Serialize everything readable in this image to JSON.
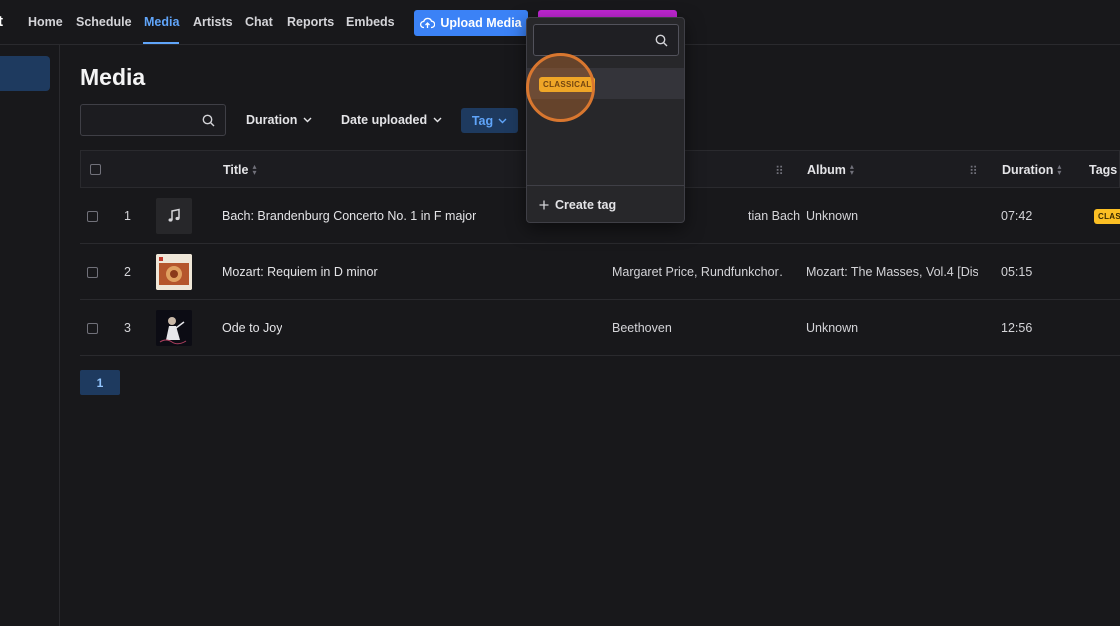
{
  "nav": {
    "logo_fragment": "t",
    "items": [
      "Home",
      "Schedule",
      "Media",
      "Artists",
      "Chat",
      "Reports",
      "Embeds"
    ],
    "upload_label": "Upload Media"
  },
  "page": {
    "title": "Media"
  },
  "filters": {
    "duration": "Duration",
    "date_uploaded": "Date uploaded",
    "tag": "Tag"
  },
  "table": {
    "headers": {
      "title": "Title",
      "album": "Album",
      "duration": "Duration",
      "tags": "Tags"
    },
    "rows": [
      {
        "index": "1",
        "title": "Bach: Brandenburg Concerto No. 1 in F major",
        "artist": "tian Bach",
        "album": "Unknown",
        "duration": "07:42",
        "tag": "CLASS"
      },
      {
        "index": "2",
        "title": "Mozart: Requiem in D minor",
        "artist": "Margaret Price, Rundfunkchor…",
        "album": "Mozart: The Masses, Vol.4 [Dis…",
        "duration": "05:15",
        "tag": ""
      },
      {
        "index": "3",
        "title": "Ode to Joy",
        "artist": "Beethoven",
        "album": "Unknown",
        "duration": "12:56",
        "tag": ""
      }
    ]
  },
  "pagination": {
    "current": "1"
  },
  "dropdown": {
    "option": "CLASSICAL",
    "create_label": "Create tag"
  },
  "colors": {
    "accent": "#3b82f6",
    "tag": "#fbbf24",
    "highlight": "#d9772f"
  }
}
